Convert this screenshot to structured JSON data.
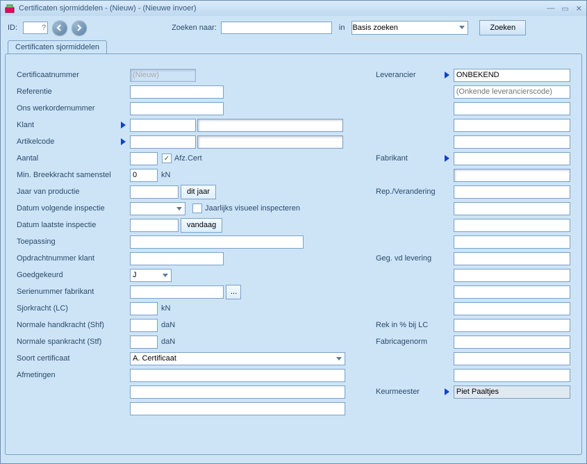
{
  "titlebar": {
    "title": "Certificaten sjormiddelen - (Nieuw) - (Nieuwe invoer)"
  },
  "toolbar": {
    "id_label": "ID:",
    "id_placeholder": "?",
    "zoeken_naar": "Zoeken naar:",
    "in_label": "in",
    "scope_selected": "Basis zoeken",
    "zoeken_btn": "Zoeken"
  },
  "tabs": {
    "main": "Certificaten sjormiddelen"
  },
  "left": {
    "certificaatnummer": {
      "label": "Certificaatnummer",
      "value": "(Nieuw)"
    },
    "referentie": {
      "label": "Referentie"
    },
    "ons_werkorder": {
      "label": "Ons werkordernummer"
    },
    "klant": {
      "label": "Klant"
    },
    "artikelcode": {
      "label": "Artikelcode"
    },
    "aantal": {
      "label": "Aantal",
      "afz_label": "Afz.Cert"
    },
    "min_breekkracht": {
      "label": "Min. Breekkracht samenstel",
      "value": "0",
      "unit": "kN"
    },
    "jaar_productie": {
      "label": "Jaar van productie",
      "btn": "dit jaar"
    },
    "datum_volgende": {
      "label": "Datum volgende inspectie",
      "chk_label": "Jaarlijks visueel inspecteren"
    },
    "datum_laatste": {
      "label": "Datum laatste inspectie",
      "btn": "vandaag"
    },
    "toepassing": {
      "label": "Toepassing"
    },
    "opdrachtnr_klant": {
      "label": "Opdrachtnummer klant"
    },
    "goedgekeurd": {
      "label": "Goedgekeurd",
      "value": "J"
    },
    "serienr_fabr": {
      "label": "Serienummer fabrikant",
      "more_btn": "..."
    },
    "sjorkracht": {
      "label": "Sjorkracht (LC)",
      "unit": "kN"
    },
    "norm_hand": {
      "label": "Normale handkracht (Shf)",
      "unit": "daN"
    },
    "norm_span": {
      "label": "Normale spankracht (Stf)",
      "unit": "daN"
    },
    "soort_cert": {
      "label": "Soort certificaat",
      "value": "A. Certificaat"
    },
    "afmetingen": {
      "label": "Afmetingen"
    }
  },
  "right": {
    "leverancier": {
      "label": "Leverancier",
      "value": "ONBEKEND"
    },
    "levcode_placeholder": "(Onkende leverancierscode)",
    "fabrikant": {
      "label": "Fabrikant"
    },
    "rep_verandering": {
      "label": "Rep./Verandering"
    },
    "geg_levering": {
      "label": "Geg. vd levering"
    },
    "rek_lc": {
      "label": "Rek in % bij LC"
    },
    "fabricagenorm": {
      "label": "Fabricagenorm"
    },
    "keurmeester": {
      "label": "Keurmeester",
      "value": "Piet Paaltjes"
    }
  }
}
